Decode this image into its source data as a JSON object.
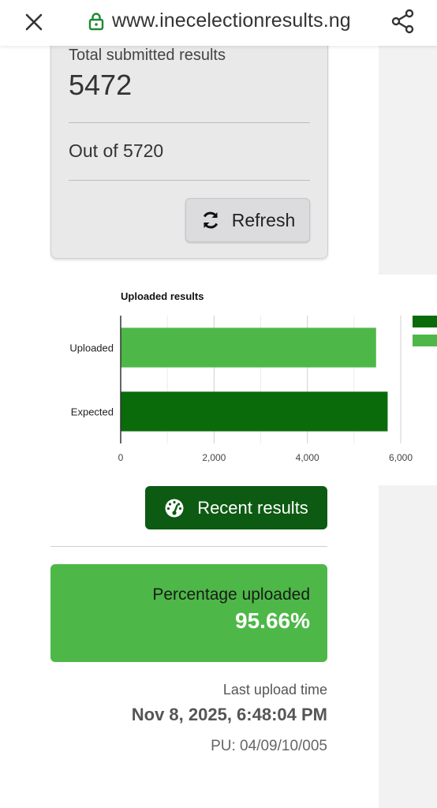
{
  "browser": {
    "url": "www.inecelectionresults.ng"
  },
  "summary": {
    "total_label": "Total submitted results",
    "total_value": "5472",
    "out_of": "Out of 5720",
    "refresh_label": "Refresh"
  },
  "chart_data": {
    "type": "bar",
    "orientation": "horizontal",
    "title": "Uploaded results",
    "categories": [
      "Uploaded",
      "Expected"
    ],
    "values": [
      5472,
      5720
    ],
    "colors": [
      "#4db847",
      "#0a6b0a"
    ],
    "xlim": [
      0,
      6000
    ],
    "xticks": [
      "0",
      "2,000",
      "4,000",
      "6,000"
    ],
    "xtick_values": [
      0,
      2000,
      4000,
      6000
    ],
    "grid": true,
    "legend": "right"
  },
  "recent_button": {
    "label": "Recent results"
  },
  "percentage": {
    "label": "Percentage uploaded",
    "value": "95.66%"
  },
  "last_upload": {
    "label": "Last upload time",
    "value": "Nov 8, 2025, 6:48:04 PM",
    "pu": "PU: 04/09/10/005"
  },
  "colors": {
    "accent_dark": "#0d5a12",
    "accent_light": "#4db847"
  }
}
